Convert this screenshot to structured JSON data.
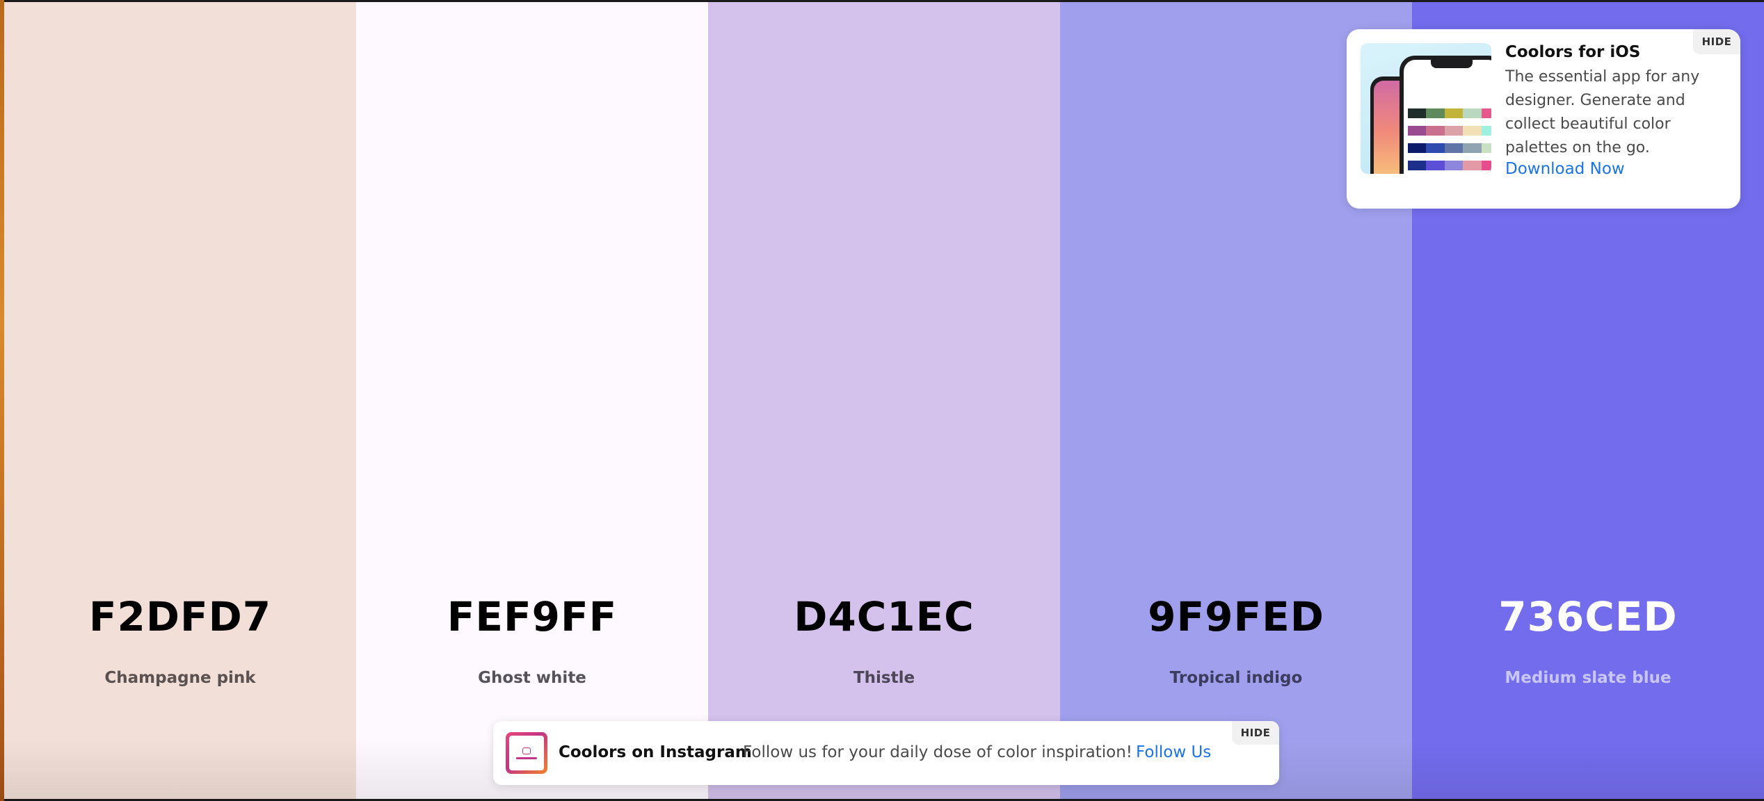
{
  "palette": {
    "swatches": [
      {
        "hex": "F2DFD7",
        "name": "Champagne pink",
        "bg": "#F2DFD7",
        "hex_color": "#000000",
        "name_color": "#5a5150"
      },
      {
        "hex": "FEF9FF",
        "name": "Ghost white",
        "bg": "#FEF9FF",
        "hex_color": "#000000",
        "name_color": "#55525a"
      },
      {
        "hex": "D4C1EC",
        "name": "Thistle",
        "bg": "#D4C1EC",
        "hex_color": "#000000",
        "name_color": "#4d4658"
      },
      {
        "hex": "9F9FED",
        "name": "Tropical indigo",
        "bg": "#9F9FED",
        "hex_color": "#000000",
        "name_color": "#3c3c5e"
      },
      {
        "hex": "736CED",
        "name": "Medium slate blue",
        "bg": "#736CED",
        "hex_color": "#ffffff",
        "name_color": "#c9c6f7"
      }
    ]
  },
  "ios_promo": {
    "title": "Coolors for iOS",
    "body": "The essential app for any designer. Generate and collect beautiful color palettes on the go.",
    "cta": "Download Now",
    "hide_label": "HIDE",
    "link_color": "#1a73e8"
  },
  "instagram_promo": {
    "title": "Coolors on Instagram",
    "text": "Follow us for your daily dose of color inspiration!",
    "cta": "Follow Us",
    "hide_label": "HIDE"
  }
}
